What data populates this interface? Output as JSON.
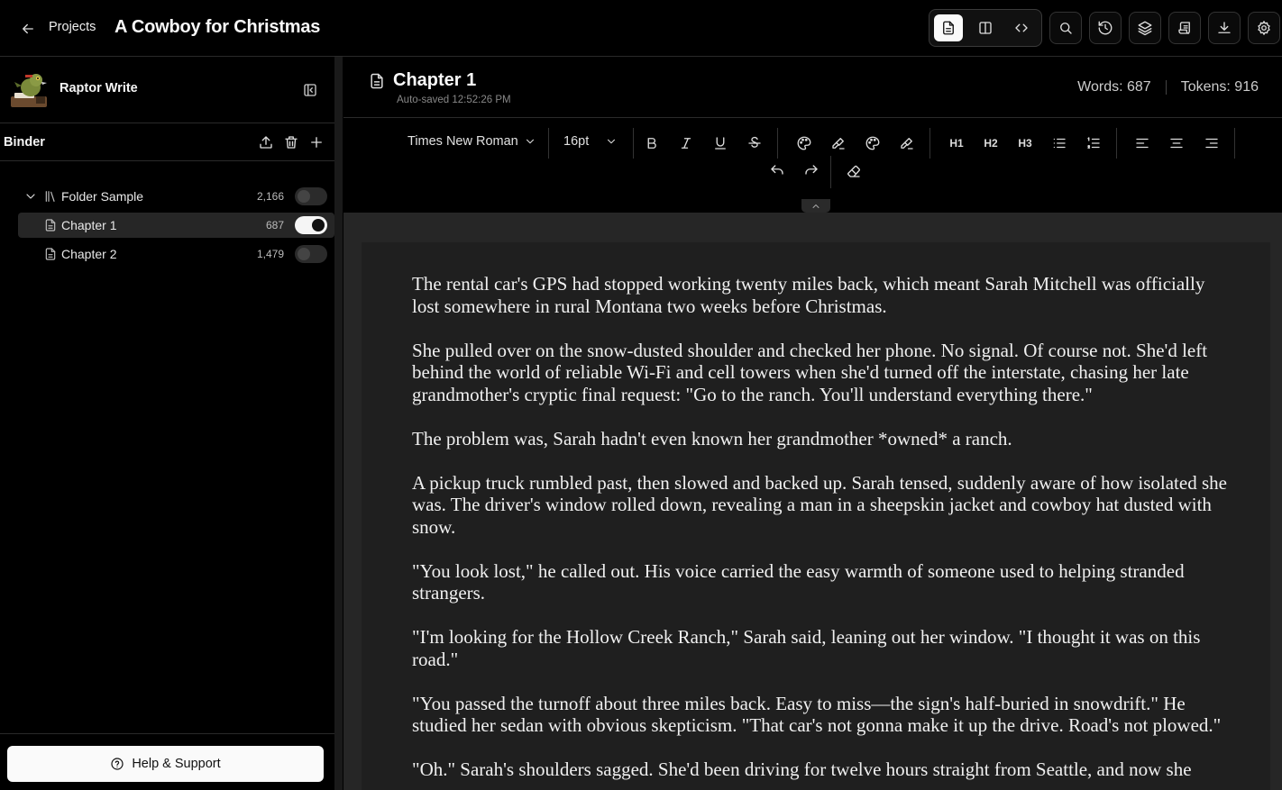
{
  "topbar": {
    "projects_label": "Projects",
    "document_title": "A Cowboy for Christmas",
    "view_modes": [
      "document-view",
      "split-view",
      "code-view"
    ],
    "active_view": "document-view",
    "tools": [
      "search",
      "history",
      "layers",
      "manuscript",
      "download",
      "settings"
    ]
  },
  "sidebar": {
    "app_name": "Raptor Write",
    "binder_title": "Binder",
    "tree": [
      {
        "type": "folder",
        "label": "Folder Sample",
        "count": "2,166",
        "enabled": false,
        "expanded": true
      },
      {
        "type": "document",
        "label": "Chapter 1",
        "count": "687",
        "enabled": true,
        "selected": true
      },
      {
        "type": "document",
        "label": "Chapter 2",
        "count": "1,479",
        "enabled": false
      }
    ],
    "help_label": "Help & Support"
  },
  "editor": {
    "chapter_title": "Chapter 1",
    "autosave": "Auto-saved 12:52:26 PM",
    "words_label": "Words:",
    "words": "687",
    "tokens_label": "Tokens:",
    "tokens": "916",
    "font_family": "Times New Roman",
    "font_size": "16pt",
    "heading_labels": {
      "h1": "H1",
      "h2": "H2",
      "h3": "H3"
    },
    "paragraphs": [
      "The rental car's GPS had stopped working twenty miles back, which meant Sarah Mitchell was officially lost somewhere in rural Montana two weeks before Christmas.",
      "She pulled over on the snow-dusted shoulder and checked her phone. No signal. Of course not. She'd left behind the world of reliable Wi-Fi and cell towers when she'd turned off the interstate, chasing her late grandmother's cryptic final request: \"Go to the ranch. You'll understand everything there.\"",
      "The problem was, Sarah hadn't even known her grandmother *owned* a ranch.",
      "A pickup truck rumbled past, then slowed and backed up. Sarah tensed, suddenly aware of how isolated she was. The driver's window rolled down, revealing a man in a sheepskin jacket and cowboy hat dusted with snow.",
      "\"You look lost,\" he called out. His voice carried the easy warmth of someone used to helping stranded strangers.",
      "\"I'm looking for the Hollow Creek Ranch,\" Sarah said, leaning out her window. \"I thought it was on this road.\"",
      "\"You passed the turnoff about three miles back. Easy to miss—the sign's half-buried in snowdrift.\" He studied her sedan with obvious skepticism. \"That car's not gonna make it up the drive. Road's not plowed.\"",
      "\"Oh.\" Sarah's shoulders sagged. She'd been driving for twelve hours straight from Seattle, and now she"
    ]
  },
  "colors": {
    "background": "#000000",
    "page": "#1f1f1f",
    "editor_bg": "#262626",
    "accent_light": "#fafafa"
  }
}
